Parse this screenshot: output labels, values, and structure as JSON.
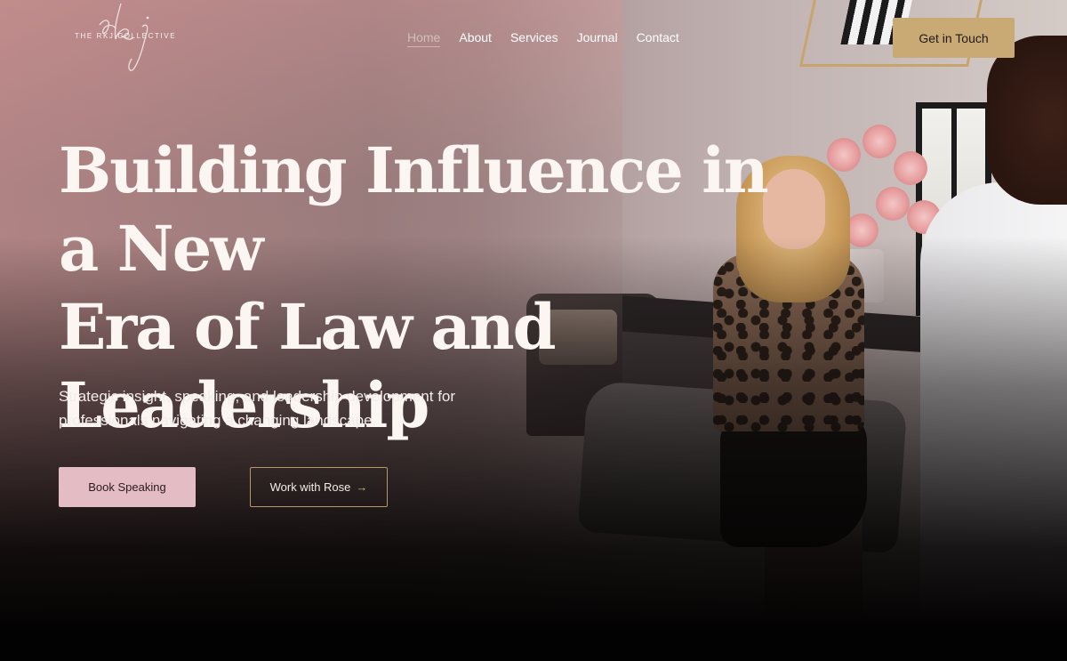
{
  "brand": {
    "monogram": "rkj",
    "name": "THE RKJ COLLECTIVE"
  },
  "nav": {
    "items": [
      {
        "label": "Home",
        "active": true
      },
      {
        "label": "About",
        "active": false
      },
      {
        "label": "Services",
        "active": false
      },
      {
        "label": "Journal",
        "active": false
      },
      {
        "label": "Contact",
        "active": false
      }
    ],
    "cta_label": "Get in Touch"
  },
  "hero": {
    "headline_line1": "Building Influence in a New",
    "headline_line2": "Era of Law and Leadership",
    "subtext_line1": "Strategic insight, speaking, and leadership development for",
    "subtext_line2": "professionals navigating a changing landscape.",
    "primary_button": "Book Speaking",
    "secondary_button": "Work with Rose",
    "secondary_icon": "arrow-right-icon"
  },
  "colors": {
    "accent_gold": "#c9aa74",
    "accent_pink": "#e4bcc4",
    "outline_gold": "#b9956a",
    "text_light": "#fbf6f2"
  }
}
